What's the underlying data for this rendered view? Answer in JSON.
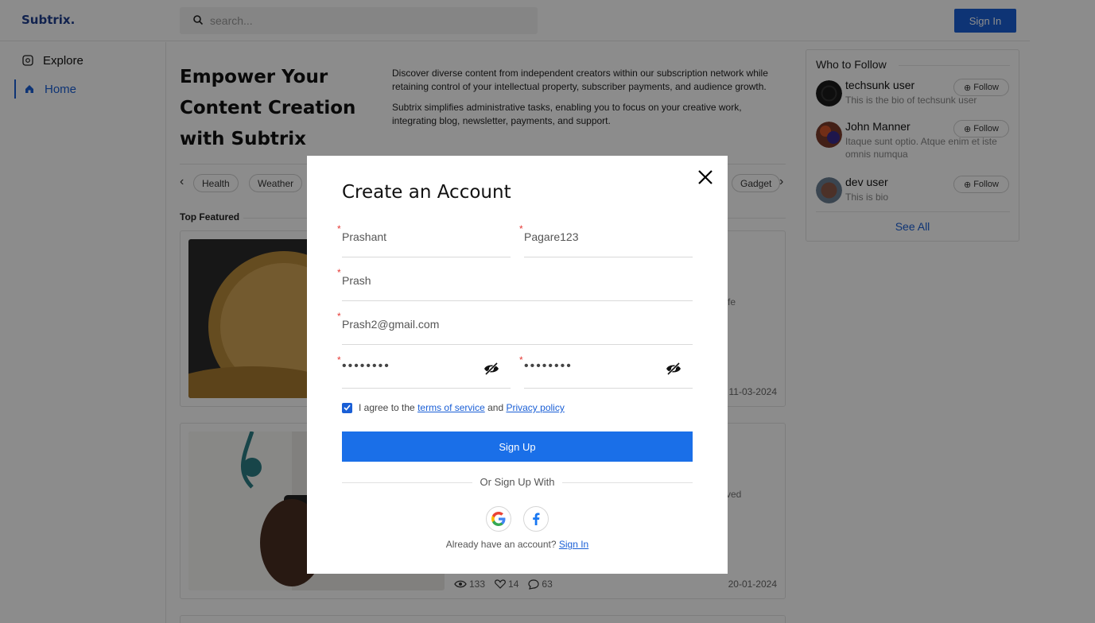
{
  "header": {
    "logo": "Subtrix.",
    "search_placeholder": "search...",
    "signin_label": "Sign In"
  },
  "sidebar": {
    "items": [
      {
        "label": "Explore",
        "icon": "explore-icon",
        "active": false
      },
      {
        "label": "Home",
        "icon": "home-icon",
        "active": true
      }
    ]
  },
  "hero": {
    "title_lines": [
      "Empower Your",
      "Content Creation",
      "with Subtrix"
    ],
    "desc1": "Discover diverse content from independent creators within our subscription network while retaining control of your intellectual property, subscriber payments, and audience growth.",
    "desc2": "Subtrix simplifies administrative tasks, enabling you to focus on your creative work, integrating blog, newsletter, payments, and support."
  },
  "tags": {
    "visible": [
      "Health",
      "Weather",
      "Gadget"
    ]
  },
  "featured": {
    "label": "Top Featured",
    "cards": [
      {
        "fragment": "fe",
        "date": "11-03-2024"
      },
      {
        "fragment": "ved",
        "date": "20-01-2024",
        "views": "133",
        "likes": "14",
        "comments": "63"
      }
    ]
  },
  "who_to_follow": {
    "title": "Who to Follow",
    "follow_label": "Follow",
    "see_all": "See All",
    "users": [
      {
        "name": "techsunk user",
        "bio": "This is the bio of techsunk user"
      },
      {
        "name": "John Manner",
        "bio": "Itaque sunt optio. Atque enim et iste omnis numqua"
      },
      {
        "name": "dev user",
        "bio": "This is bio"
      }
    ]
  },
  "modal": {
    "title": "Create an Account",
    "first_name": "Prashant",
    "last_name": "Pagare123",
    "username": "Prash",
    "email": "Prash2@gmail.com",
    "password_mask": "••••••••",
    "confirm_mask": "••••••••",
    "agree_prefix": "I agree to the",
    "terms_link": "terms of service",
    "and_text": "and",
    "privacy_link": "Privacy policy",
    "agree_checked": true,
    "signup_label": "Sign Up",
    "or_text": "Or Sign Up With",
    "already_text": "Already have an account?",
    "signin_link": "Sign In"
  },
  "colors": {
    "accent": "#1a5fd6",
    "signup_button": "#1a6fe8",
    "required_star": "#e53935",
    "logo": "#1f3f8f"
  }
}
